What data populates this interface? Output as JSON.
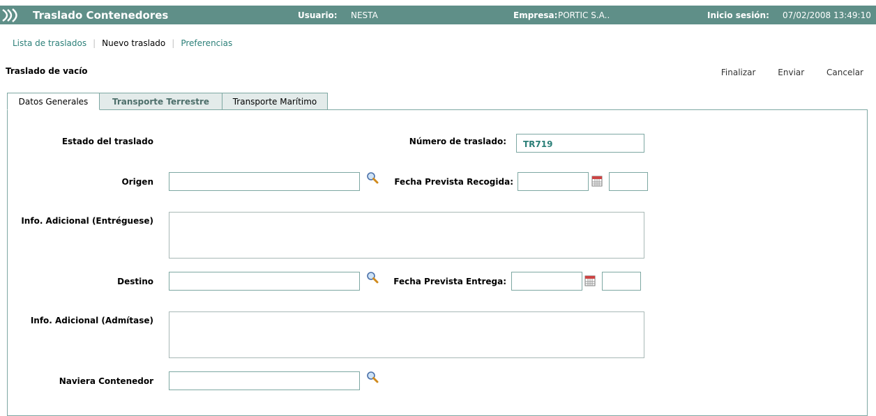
{
  "header": {
    "app_title": "Traslado Contenedores",
    "user_label": "Usuario:",
    "user_value": "NESTA",
    "company_label": "Empresa:",
    "company_value": "PORTIC S.A..",
    "session_label": "Inicio sesión:",
    "session_value": "07/02/2008 13:49:10",
    "bg_color": "#5f8f88"
  },
  "nav": {
    "items": [
      "Lista de traslados",
      "Nuevo traslado",
      "Preferencias"
    ]
  },
  "page": {
    "title": "Traslado de vacío",
    "actions": [
      "Finalizar",
      "Enviar",
      "Cancelar"
    ]
  },
  "tabs": [
    "Datos Generales",
    "Transporte Terrestre",
    "Transporte Marítimo"
  ],
  "form": {
    "estado_label": "Estado del traslado",
    "numero_label": "Número de traslado:",
    "numero_value": "TR719",
    "origen_label": "Origen",
    "origen_value": "",
    "fecha_recogida_label": "Fecha Prevista Recogida:",
    "info_entreguese_label": "Info. Adicional (Entréguese)",
    "destino_label": "Destino",
    "destino_value": "",
    "fecha_entrega_label": "Fecha Prevista Entrega:",
    "info_admitase_label": "Info. Adicional (Admítase)",
    "naviera_label": "Naviera Contenedor",
    "naviera_value": ""
  }
}
